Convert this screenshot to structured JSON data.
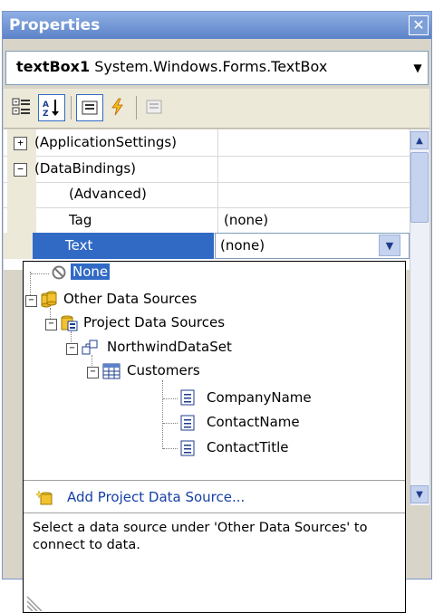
{
  "window": {
    "title": "Properties"
  },
  "object_selector": {
    "name": "textBox1",
    "type": "System.Windows.Forms.TextBox"
  },
  "toolbar": {
    "buttons": [
      "categorized-icon",
      "alphabetical-icon",
      "properties-icon",
      "events-icon",
      "property-pages-icon"
    ]
  },
  "grid": {
    "categories": [
      {
        "label": "(ApplicationSettings)",
        "expander": "+"
      },
      {
        "label": "(DataBindings)",
        "expander": "−"
      }
    ],
    "properties": [
      {
        "name": "(Advanced)",
        "value": ""
      },
      {
        "name": "Tag",
        "value": "(none)"
      },
      {
        "name": "Text",
        "value": "(none)"
      }
    ]
  },
  "dropdown": {
    "tree": {
      "none": "None",
      "other": "Other Data Sources",
      "project": "Project Data Sources",
      "dataset": "NorthwindDataSet",
      "table": "Customers",
      "fields": [
        "CompanyName",
        "ContactName",
        "ContactTitle"
      ]
    },
    "add_link": "Add Project Data Source...",
    "help": "Select a data source under 'Other Data Sources' to connect to data."
  },
  "colors": {
    "selection": "#316ac5",
    "title_bar": "#5c82c8",
    "link": "#1540a8"
  }
}
